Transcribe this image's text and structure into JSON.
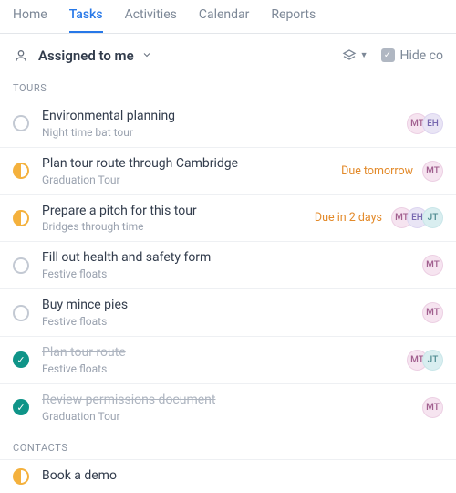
{
  "nav": {
    "items": [
      "Home",
      "Tasks",
      "Activities",
      "Calendar",
      "Reports"
    ],
    "active": 1
  },
  "title_bar": {
    "label": "Assigned to me",
    "hide_text": "Hide co"
  },
  "sections": [
    {
      "header": "TOURS",
      "tasks": [
        {
          "title": "Environmental planning",
          "sub": "Night time bat tour",
          "status": "empty",
          "due": "",
          "avatars": [
            {
              "txt": "MT",
              "cls": "pink"
            },
            {
              "txt": "EH",
              "cls": "lav"
            }
          ]
        },
        {
          "title": "Plan tour route through Cambridge",
          "sub": "Graduation Tour",
          "status": "half",
          "due": "Due tomorrow",
          "avatars": [
            {
              "txt": "MT",
              "cls": "pink"
            }
          ]
        },
        {
          "title": "Prepare a pitch for this tour",
          "sub": "Bridges through time",
          "status": "half",
          "due": "Due in 2 days",
          "avatars": [
            {
              "txt": "MT",
              "cls": "pink"
            },
            {
              "txt": "EH",
              "cls": "lav"
            },
            {
              "txt": "JT",
              "cls": "teal"
            }
          ]
        },
        {
          "title": "Fill out health and safety form",
          "sub": "Festive floats",
          "status": "empty",
          "due": "",
          "avatars": [
            {
              "txt": "MT",
              "cls": "pink"
            }
          ]
        },
        {
          "title": "Buy mince pies",
          "sub": "Festive floats",
          "status": "empty",
          "due": "",
          "avatars": [
            {
              "txt": "MT",
              "cls": "pink"
            }
          ]
        },
        {
          "title": "Plan tour route",
          "sub": "Festive floats",
          "status": "done",
          "due": "",
          "struck": true,
          "avatars": [
            {
              "txt": "MT",
              "cls": "pink"
            },
            {
              "txt": "JT",
              "cls": "teal"
            }
          ]
        },
        {
          "title": "Review permissions document",
          "sub": "Graduation Tour",
          "status": "done",
          "due": "",
          "struck": true,
          "avatars": [
            {
              "txt": "MT",
              "cls": "pink"
            }
          ]
        }
      ]
    },
    {
      "header": "CONTACTS",
      "tasks": [
        {
          "title": "Book a demo",
          "sub": "",
          "status": "half",
          "due": "",
          "avatars": []
        }
      ]
    }
  ]
}
